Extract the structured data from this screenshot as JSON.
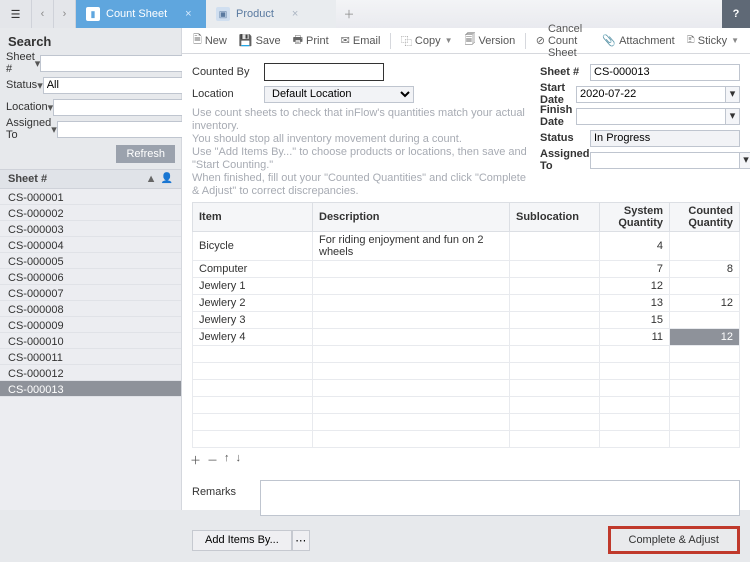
{
  "tabs": [
    {
      "label": "Count Sheet",
      "active": true
    },
    {
      "label": "Product",
      "active": false
    }
  ],
  "sidebar": {
    "title": "Search",
    "filters": {
      "sheet_label": "Sheet #",
      "sheet_value": "",
      "status_label": "Status",
      "status_value": "All",
      "location_label": "Location",
      "location_value": "",
      "assigned_label": "Assigned To",
      "assigned_value": ""
    },
    "refresh": "Refresh",
    "list_header": "Sheet #",
    "items": [
      "CS-000001",
      "CS-000002",
      "CS-000003",
      "CS-000004",
      "CS-000005",
      "CS-000006",
      "CS-000007",
      "CS-000008",
      "CS-000009",
      "CS-000010",
      "CS-000011",
      "CS-000012",
      "CS-000013"
    ],
    "selected": "CS-000013"
  },
  "toolbar": {
    "new": "New",
    "save": "Save",
    "print": "Print",
    "email": "Email",
    "copy": "Copy",
    "version": "Version",
    "cancel": "Cancel Count Sheet",
    "attachment": "Attachment",
    "sticky": "Sticky"
  },
  "form": {
    "counted_by_label": "Counted By",
    "counted_by": "",
    "location_label": "Location",
    "location": "Default Location",
    "help1": "Use count sheets to check that inFlow's quantities match your actual inventory.",
    "help2": "You should stop all inventory movement during a count.",
    "help3": "Use \"Add Items By...\" to choose products or locations, then save and \"Start Counting.\"",
    "help4": "When finished, fill out your \"Counted Quantities\" and click \"Complete & Adjust\" to correct discrepancies.",
    "sheet_label": "Sheet #",
    "sheet": "CS-000013",
    "start_label": "Start Date",
    "start": "2020-07-22",
    "finish_label": "Finish Date",
    "finish": "",
    "status_label": "Status",
    "status": "In Progress",
    "assigned_label": "Assigned To",
    "assigned": ""
  },
  "grid": {
    "h_item": "Item",
    "h_desc": "Description",
    "h_sub": "Sublocation",
    "h_sys": "System Quantity",
    "h_cnt": "Counted Quantity",
    "rows": [
      {
        "item": "Bicycle",
        "desc": "For riding enjoyment and fun on 2 wheels",
        "sub": "",
        "sys": "4",
        "cnt": ""
      },
      {
        "item": "Computer",
        "desc": "",
        "sub": "",
        "sys": "7",
        "cnt": "8"
      },
      {
        "item": "Jewlery 1",
        "desc": "",
        "sub": "",
        "sys": "12",
        "cnt": ""
      },
      {
        "item": "Jewlery 2",
        "desc": "",
        "sub": "",
        "sys": "13",
        "cnt": "12"
      },
      {
        "item": "Jewlery 3",
        "desc": "",
        "sub": "",
        "sys": "15",
        "cnt": ""
      },
      {
        "item": "Jewlery 4",
        "desc": "",
        "sub": "",
        "sys": "11",
        "cnt": "12",
        "hilite": true
      }
    ]
  },
  "remarks_label": "Remarks",
  "remarks": "",
  "footer": {
    "add": "Add Items By...",
    "complete": "Complete & Adjust"
  }
}
